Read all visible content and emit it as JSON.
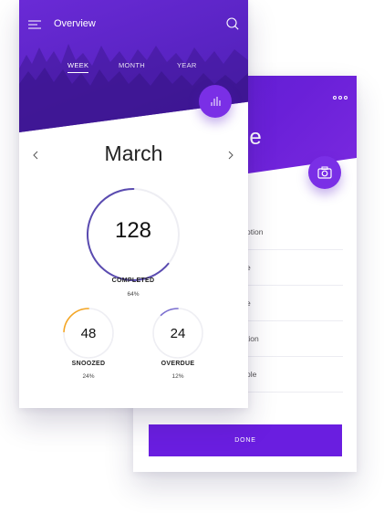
{
  "front": {
    "header": {
      "title": "Overview"
    },
    "tabs": [
      {
        "label": "WEEK",
        "active": true
      },
      {
        "label": "MONTH",
        "active": false
      },
      {
        "label": "YEAR",
        "active": false
      }
    ],
    "month": "March",
    "completed": {
      "value": "128",
      "label": "COMPLETED",
      "percent": "64%",
      "fraction": 0.64,
      "color": "#5a4bb0"
    },
    "snoozed": {
      "value": "48",
      "label": "SNOOZED",
      "percent": "24%",
      "fraction": 0.24,
      "color": "#f5a623"
    },
    "overdue": {
      "value": "24",
      "label": "OVERDUE",
      "percent": "12%",
      "fraction": 0.12,
      "color": "#7b6fd0"
    }
  },
  "back": {
    "title_fragment": "le",
    "rows": [
      "ption",
      "e",
      "e",
      "tion",
      "ple"
    ],
    "done_label": "DONE"
  },
  "colors": {
    "accent": "#6a1ee0",
    "header_dark": "#4a1fae"
  },
  "icons": [
    "menu-icon",
    "search-icon",
    "bar-chart-icon",
    "chevron-left-icon",
    "chevron-right-icon",
    "more-icon",
    "camera-icon"
  ]
}
